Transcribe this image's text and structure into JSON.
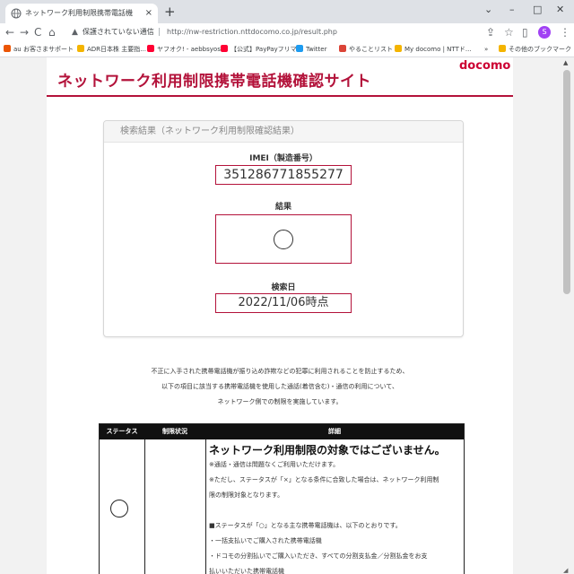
{
  "browser": {
    "tab_title": "ネットワーク利用制限携帯電話機確",
    "tab_close": "×",
    "new_tab": "+",
    "win_minimize": "–",
    "win_maximize": "□",
    "win_close": "✕",
    "tab_menu": "⌄",
    "nav_back": "←",
    "nav_forward": "→",
    "nav_reload": "C",
    "nav_home": "⌂",
    "security_text": "保護されていない通信",
    "url": "http://nw-restriction.nttdocomo.co.jp/result.php",
    "share_icon": "⇪",
    "star_icon": "☆",
    "sidepanel_icon": "▯",
    "avatar_letter": "S",
    "menu_icon": "⋮",
    "bookmarks": [
      {
        "label": "au お客さまサポート",
        "color": "#eb5505"
      },
      {
        "label": "ADR日本株 主要指...",
        "color": "#f4b400"
      },
      {
        "label": "ヤフオク! - aebbsyos...",
        "color": "#ff0033"
      },
      {
        "label": "【公式】PayPayフリマ...",
        "color": "#ff0033"
      },
      {
        "label": "Twitter",
        "color": "#1d9bf0"
      },
      {
        "label": "やることリスト",
        "color": "#db4437"
      },
      {
        "label": "My docomo | NTTド...",
        "color": "#f4b400"
      },
      {
        "label": "»",
        "color": ""
      },
      {
        "label": "その他のブックマーク",
        "color": "#f4b400"
      }
    ]
  },
  "site": {
    "title": "ネットワーク利用制限携帯電話機確認サイト",
    "logo": "docomo"
  },
  "result_card": {
    "heading": "検索結果（ネットワーク利用制限確認結果）",
    "imei_label": "IMEI（製造番号）",
    "imei_value": "351286771855277",
    "result_label": "結果",
    "result_symbol": "○",
    "date_label": "検索日",
    "date_value": "2022/11/06時点"
  },
  "notice_lines": [
    "不正に入手された携帯電話機が振り込め詐欺などの犯罪に利用されることを防止するため、",
    "以下の項目に該当する携帯電話機を使用した通話(着信含む)・通信の利用について、",
    "ネットワーク側での制限を実施しています。"
  ],
  "status_table": {
    "headers": [
      "ステータス",
      "制限状況",
      "詳細"
    ],
    "status_symbol": "○",
    "detail_heading": "ネットワーク利用制限の対象ではございません。",
    "detail_lines": [
      "※通話・通信は問題なくご利用いただけます。",
      "※ただし、ステータスが「×」となる条件に合致した場合は、ネットワーク利用制",
      "限の制限対象となります。",
      "",
      "■ステータスが「○」となる主な携帯電話機は、以下のとおりです。",
      "・一括支払いでご購入された携帯電話機",
      "・ドコモの分割払いでご購入いただき、すべての分割支払金／分割払金をお支",
      "払いいただいた携帯電話機"
    ]
  }
}
